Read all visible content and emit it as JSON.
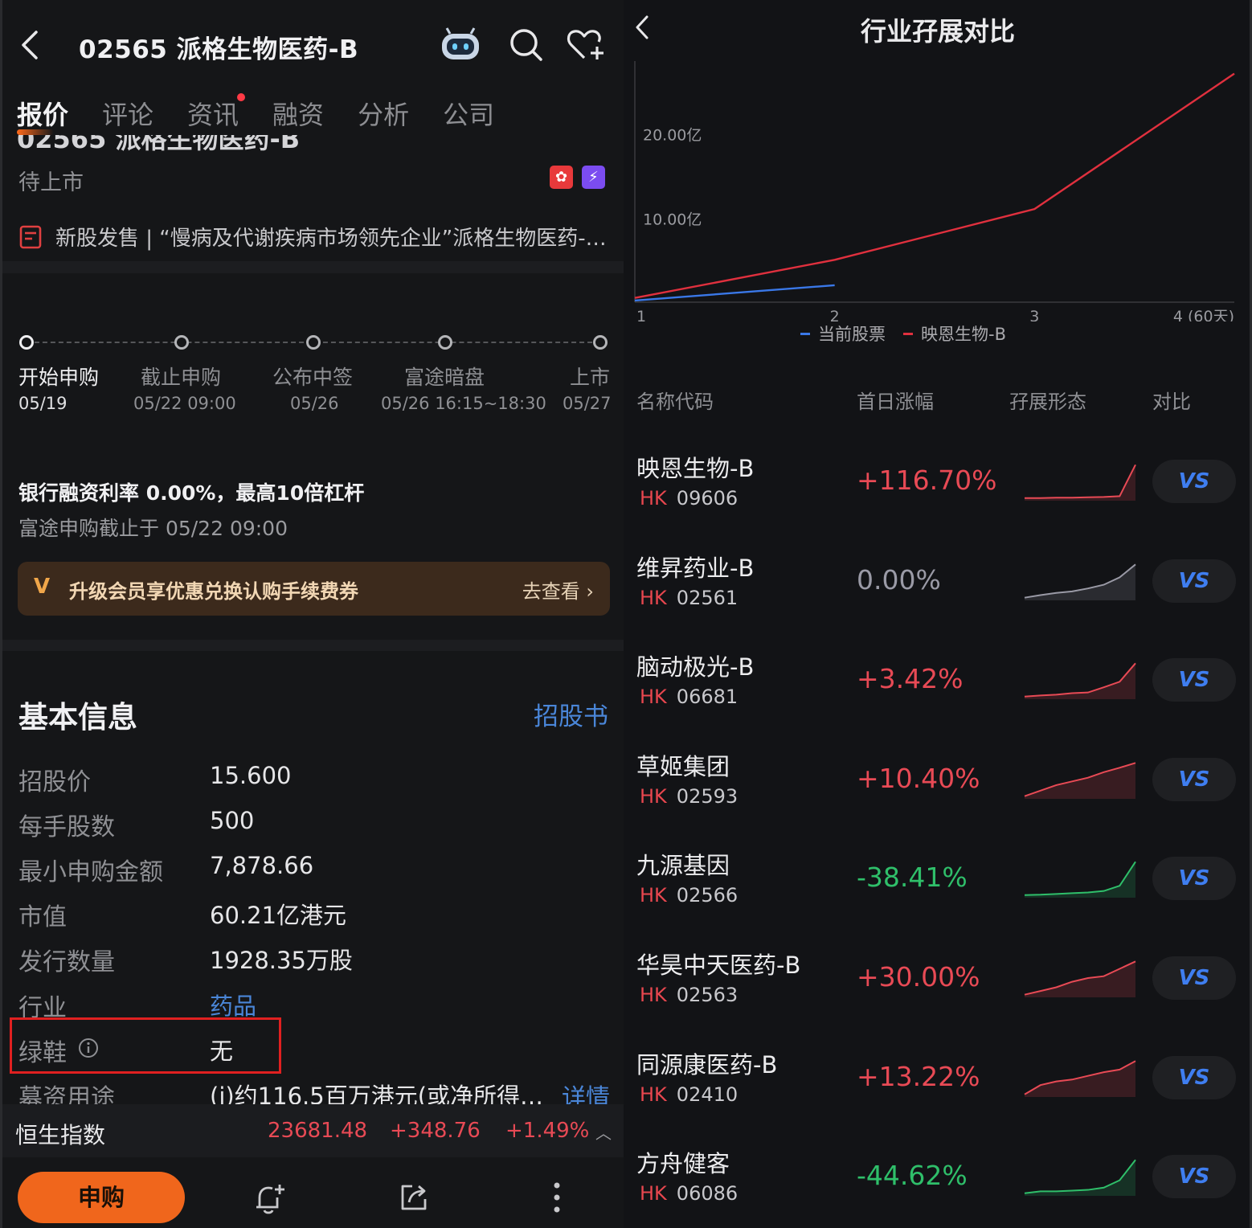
{
  "left": {
    "header": {
      "title": "02565  派格生物医药-B",
      "icons": [
        "back-icon",
        "robot-icon",
        "search-icon",
        "heart-add-icon"
      ]
    },
    "tabs": [
      {
        "label": "报价",
        "active": true
      },
      {
        "label": "评论"
      },
      {
        "label": "资讯",
        "has_dot": true
      },
      {
        "label": "融资"
      },
      {
        "label": "分析"
      },
      {
        "label": "公司"
      }
    ],
    "status": "待上市",
    "badges": {
      "hk": "✿",
      "b": "⚡"
    },
    "news": "新股发售 | “慢病及代谢疾病市场领先企业”派格生物医药-…",
    "timeline": [
      {
        "label": "开始申购",
        "date": "05/19"
      },
      {
        "label": "截止申购",
        "date": "05/22 09:00"
      },
      {
        "label": "公布中签",
        "date": "05/26"
      },
      {
        "label": "富途暗盘",
        "date": "05/26 16:15~18:30"
      },
      {
        "label": "上市",
        "date": "05/27"
      }
    ],
    "loan": {
      "title": "银行融资利率 0.00%，最高10倍杠杆",
      "sub": "富途申购截止于 05/22 09:00"
    },
    "promo": {
      "icon": "V",
      "text": "升级会员享优惠兑换认购手续费券",
      "link": "去查看"
    },
    "basic_info": {
      "title": "基本信息",
      "prospectus_link": "招股书",
      "rows": [
        {
          "k": "招股价",
          "v": "15.600"
        },
        {
          "k": "每手股数",
          "v": "500"
        },
        {
          "k": "最小申购金额",
          "v": "7,878.66"
        },
        {
          "k": "市值",
          "v": "60.21亿港元"
        },
        {
          "k": "发行数量",
          "v": "1928.35万股"
        },
        {
          "k": "行业",
          "v": "药品"
        },
        {
          "k": "绿鞋",
          "v": "无"
        },
        {
          "k": "募资用途",
          "v": "(i)约116.5百万港元(或净所得…",
          "more": "详情"
        }
      ]
    },
    "index_bar": {
      "name": "恒生指数",
      "value": "23681.48",
      "change": "+348.76",
      "pct": "+1.49%",
      "caret": "︿"
    },
    "bottom": {
      "subscribe": "申购"
    },
    "colors": {
      "accent": "#f0661c",
      "link": "#4a86d8",
      "up": "#e84a55"
    }
  },
  "right": {
    "title": "行业孖展对比",
    "legend": [
      {
        "name": "当前股票",
        "color": "#3a78e8"
      },
      {
        "name": "映恩生物-B",
        "color": "#e0303e"
      }
    ],
    "table_headers": [
      "名称代码",
      "首日涨幅",
      "孖展形态",
      "对比"
    ],
    "rows": [
      {
        "name": "映恩生物-B",
        "market": "HK",
        "code": "09606",
        "pct": "+116.70%",
        "trend": "up",
        "spark": [
          0.05,
          0.05,
          0.06,
          0.06,
          0.07,
          0.08,
          0.1,
          0.95
        ],
        "vs": "VS"
      },
      {
        "name": "维昇药业-B",
        "market": "HK",
        "code": "02561",
        "pct": "0.00%",
        "trend": "flat",
        "spark": [
          0.05,
          0.12,
          0.18,
          0.22,
          0.3,
          0.4,
          0.6,
          0.95
        ],
        "vs": "VS"
      },
      {
        "name": "脑动极光-B",
        "market": "HK",
        "code": "06681",
        "pct": "+3.42%",
        "trend": "up",
        "spark": [
          0.05,
          0.08,
          0.1,
          0.14,
          0.16,
          0.3,
          0.45,
          0.95
        ],
        "vs": "VS"
      },
      {
        "name": "草姬集团",
        "market": "HK",
        "code": "02593",
        "pct": "+10.40%",
        "trend": "up",
        "spark": [
          0.05,
          0.2,
          0.35,
          0.45,
          0.55,
          0.7,
          0.82,
          0.95
        ],
        "vs": "VS"
      },
      {
        "name": "九源基因",
        "market": "HK",
        "code": "02566",
        "pct": "-38.41%",
        "trend": "down",
        "spark": [
          0.05,
          0.06,
          0.08,
          0.1,
          0.12,
          0.16,
          0.3,
          0.95
        ],
        "vs": "VS"
      },
      {
        "name": "华昊中天医药-B",
        "market": "HK",
        "code": "02563",
        "pct": "+30.00%",
        "trend": "up",
        "spark": [
          0.05,
          0.15,
          0.25,
          0.4,
          0.5,
          0.55,
          0.75,
          0.95
        ],
        "vs": "VS"
      },
      {
        "name": "同源康医药-B",
        "market": "HK",
        "code": "02410",
        "pct": "+13.22%",
        "trend": "up",
        "spark": [
          0.05,
          0.3,
          0.4,
          0.45,
          0.55,
          0.65,
          0.72,
          0.95
        ],
        "vs": "VS"
      },
      {
        "name": "方舟健客",
        "market": "HK",
        "code": "06086",
        "pct": "-44.62%",
        "trend": "down",
        "spark": [
          0.05,
          0.1,
          0.1,
          0.12,
          0.14,
          0.2,
          0.4,
          0.95
        ],
        "vs": "VS"
      }
    ],
    "colors": {
      "up": "#e84a55",
      "down": "#2fbf6a",
      "flat": "#9a9aa6",
      "vs": "#3f7ef0"
    }
  },
  "chart_data": {
    "type": "line",
    "title": "行业孖展对比",
    "x": [
      1,
      2,
      3,
      4
    ],
    "x_tick_labels": [
      "1",
      "2",
      "3",
      "4 (60天)"
    ],
    "y_tick_labels": [
      "10.00亿",
      "20.00亿"
    ],
    "ylim": [
      0,
      30
    ],
    "series": [
      {
        "name": "当前股票",
        "x": [
          1,
          2
        ],
        "values": [
          0.2,
          2.0
        ],
        "color": "#3a78e8"
      },
      {
        "name": "映恩生物-B",
        "x": [
          1,
          2,
          3,
          4
        ],
        "values": [
          0.5,
          5.0,
          11.0,
          27.0
        ],
        "color": "#e0303e"
      }
    ],
    "grid": false,
    "legend_position": "bottom"
  }
}
